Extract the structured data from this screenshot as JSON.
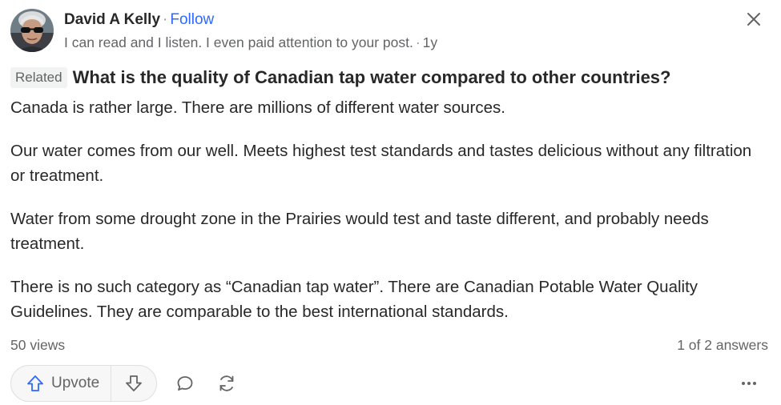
{
  "author": {
    "name": "David A Kelly",
    "follow_label": "Follow",
    "credential": "I can read and I listen. I even paid attention to your post.",
    "age": "1y",
    "avatar_icon": "avatar-sunglasses"
  },
  "question": {
    "badge": "Related",
    "title": "What is the quality of Canadian tap water compared to other countries?"
  },
  "answer": {
    "paragraphs": [
      "Canada is rather large. There are millions of different water sources.",
      "Our water comes from our well. Meets highest test standards and tastes delicious without any filtration or treatment.",
      "Water from some drought zone in the Prairies would test and taste different, and probably needs treatment.",
      "There is no such category as “Canadian tap water”. There are Canadian Potable Water Quality Guidelines. They are comparable to the best international standards."
    ]
  },
  "meta": {
    "views": "50 views",
    "answers": "1 of 2 answers"
  },
  "actions": {
    "upvote_label": "Upvote",
    "icons": {
      "upvote": "arrow-up-icon",
      "downvote": "arrow-down-icon",
      "comment": "comment-icon",
      "share": "share-icon",
      "more": "more-icon",
      "close": "close-icon"
    }
  },
  "colors": {
    "accent": "#2e69ff",
    "text": "#282829",
    "secondary": "#636466"
  }
}
